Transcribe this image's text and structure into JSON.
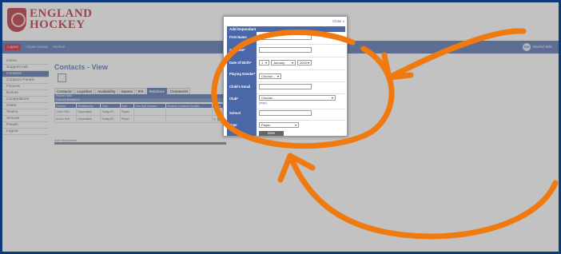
{
  "header": {
    "logo_line1": "ENGLAND",
    "logo_line2": "HOCKEY"
  },
  "topnav": {
    "logout": "Logout",
    "links": [
      "Close contact",
      "Archive"
    ],
    "user_initials": "RW",
    "user_name": "Rachel Wils"
  },
  "sidebar": {
    "items": [
      {
        "label": "Home",
        "active": false
      },
      {
        "label": "Support Hub",
        "active": false
      },
      {
        "label": "Contacts",
        "active": true
      },
      {
        "label": "Contacts Panels",
        "active": false
      },
      {
        "label": "Fixtures",
        "active": false
      },
      {
        "label": "Events",
        "active": false
      },
      {
        "label": "Competitions",
        "active": false
      },
      {
        "label": "Clubs",
        "active": false
      },
      {
        "label": "Teams",
        "active": false
      },
      {
        "label": "Venues",
        "active": false
      },
      {
        "label": "Panels",
        "active": false
      },
      {
        "label": "Logout",
        "active": false
      }
    ]
  },
  "main": {
    "title": "Contacts - View",
    "tabs": [
      {
        "label": "Contacts",
        "active": false
      },
      {
        "label": "Loyalties",
        "active": false
      },
      {
        "label": "Availability",
        "active": false
      },
      {
        "label": "Games",
        "active": false
      },
      {
        "label": "IFA",
        "active": false
      },
      {
        "label": "Relations",
        "active": true
      },
      {
        "label": "Comments",
        "active": false
      }
    ],
    "grid_header": "Rachel Wils",
    "grid_subheader": "Current Relations",
    "columns": [
      "Contact",
      "Relationship",
      "Club",
      "Role",
      "Can Edit Contact",
      "Receive Contact's Emails",
      "Action"
    ],
    "rows": [
      [
        "Oliver Wils",
        "Dependant",
        "Sotrig HC",
        "Player",
        "",
        "",
        ""
      ],
      [
        "Austin Wils",
        "Dependant",
        "Sotrig HC",
        "Player",
        "",
        "",
        ""
      ]
    ],
    "add_link": "Add Dependant"
  },
  "modal": {
    "close": "Close x",
    "title": "Add Dependant",
    "fields": {
      "first_name": {
        "label": "First Name",
        "value": ""
      },
      "surname": {
        "label": "Surname*",
        "value": ""
      },
      "dob": {
        "label": "Date Of Birth*",
        "day": "1",
        "month": "January",
        "year": "2003"
      },
      "gender": {
        "label": "Playing Gender*",
        "value": "Choose..."
      },
      "email": {
        "label": "Child's Email",
        "value": ""
      },
      "club": {
        "label": "Club*",
        "value": "Choose...",
        "map_link": "[map]"
      },
      "school": {
        "label": "School",
        "value": ""
      },
      "type": {
        "label": "Type",
        "value": "Player"
      }
    },
    "save": "Save"
  },
  "colors": {
    "brand_red": "#b51f2e",
    "nav_blue": "#4a67a8",
    "annotation_orange": "#f07a0f",
    "border_navy": "#0d3a7a"
  }
}
